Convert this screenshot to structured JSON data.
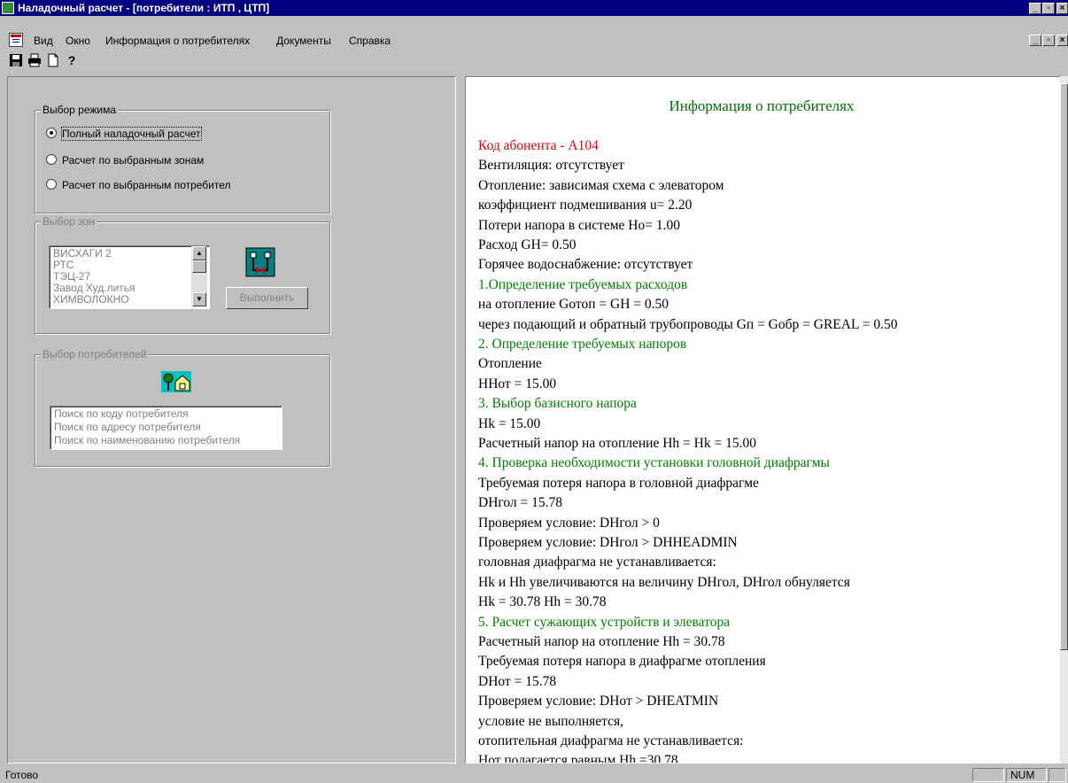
{
  "window": {
    "title": "Наладочный расчет - [потребители : ИТП , ЦТП]",
    "min_glyph": "_",
    "max_glyph": "▫",
    "close_glyph": "×"
  },
  "menu": {
    "items": [
      "Вид",
      "Окно",
      "Информация о потребителях",
      "Документы",
      "Справка"
    ]
  },
  "toolbar": {
    "icons": [
      "save-icon",
      "print-icon",
      "new-document-icon",
      "help-icon"
    ],
    "help_glyph": "?"
  },
  "mode_group": {
    "legend": "Выбор режима",
    "options": [
      {
        "label": "Полный наладочный расчет",
        "selected": true
      },
      {
        "label": "Расчет по выбранным зонам",
        "selected": false
      },
      {
        "label": "Расчет по выбранным потребител",
        "selected": false
      }
    ]
  },
  "zones_group": {
    "legend": "Выбор зон",
    "items": [
      "ВИСХАГИ 2",
      "РТС",
      "ТЭЦ-27",
      "Завод Худ.литья",
      "ХИМВОЛОКНО"
    ],
    "execute_label": "Выполнить"
  },
  "consumers_group": {
    "legend": "Выбор потребителей",
    "search_items": [
      "Поиск по коду потребителя",
      "Поиск по адресу потребителя",
      "Поиск по наименованию потребителя"
    ]
  },
  "report": {
    "heading": "Информация о потребителях",
    "lines": [
      {
        "text": "Код абонента - А104",
        "style": "red"
      },
      {
        "text": "Вентиляция: отсутствует",
        "style": "normal"
      },
      {
        "text": "Отопление: зависимая схема с элеватором",
        "style": "normal"
      },
      {
        "text": "коэффициент подмешивания u= 2.20",
        "style": "normal"
      },
      {
        "text": "Потери напора в системе Ho= 1.00",
        "style": "normal"
      },
      {
        "text": "Расход GH= 0.50",
        "style": "normal"
      },
      {
        "text": "Горячее водоснабжение: отсутствует",
        "style": "normal"
      },
      {
        "text": "1.Определение требуемых расходов",
        "style": "green"
      },
      {
        "text": "на отопление Gотоп = GH = 0.50",
        "style": "normal"
      },
      {
        "text": "через подающий и обратный трубопроводы Gп = Gобр = GREAL = 0.50",
        "style": "normal"
      },
      {
        "text": "2. Определение требуемых напоров",
        "style": "green"
      },
      {
        "text": "Отопление",
        "style": "normal"
      },
      {
        "text": "HHот = 15.00",
        "style": "normal"
      },
      {
        "text": "3. Выбор базисного напора",
        "style": "green"
      },
      {
        "text": "Hk = 15.00",
        "style": "normal"
      },
      {
        "text": "Расчетный напор на отопление Hh = Hk = 15.00",
        "style": "normal"
      },
      {
        "text": "4. Проверка необходимости установки головной диафрагмы",
        "style": "green"
      },
      {
        "text": "Требуемая потеря напора в головной диафрагме",
        "style": "normal"
      },
      {
        "text": "DHгол = 15.78",
        "style": "normal"
      },
      {
        "text": "Проверяем условие: DHгол > 0",
        "style": "normal"
      },
      {
        "text": "Проверяем условие: DHгол > DHHEADMIN",
        "style": "normal"
      },
      {
        "text": "головная диафрагма не устанавливается:",
        "style": "normal"
      },
      {
        "text": "Hk и Hh увеличиваются на величину DHгол, DHгол обнуляется",
        "style": "normal"
      },
      {
        "text": "Hk = 30.78 Hh = 30.78",
        "style": "normal"
      },
      {
        "text": "5. Расчет сужающих устройств и элеватора",
        "style": "green"
      },
      {
        "text": "Расчетный напор на отопление Hh = 30.78",
        "style": "normal"
      },
      {
        "text": "Требуемая потеря напора в диафрагме отопления",
        "style": "normal"
      },
      {
        "text": "DHот = 15.78",
        "style": "normal"
      },
      {
        "text": "Проверяем условие: DHот > DHEATMIN",
        "style": "normal"
      },
      {
        "text": "условие не выполняется,",
        "style": "normal"
      },
      {
        "text": "отопительная диафрагма не устанавливается:",
        "style": "normal"
      },
      {
        "text": "Hот полагается равным Hh =30.78",
        "style": "normal"
      }
    ]
  },
  "statusbar": {
    "text": "Готово",
    "num": "NUM"
  }
}
